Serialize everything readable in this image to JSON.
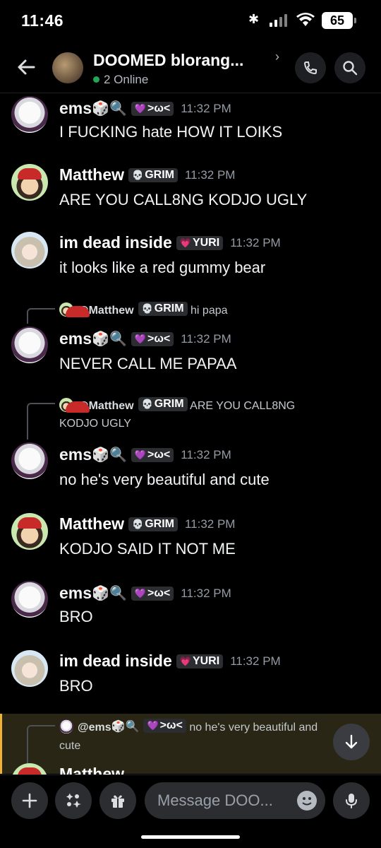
{
  "status": {
    "time": "11:46",
    "battery": "65"
  },
  "header": {
    "title": "DOOMED blorang...",
    "online": "2 Online"
  },
  "messages": [
    {
      "author": "ems",
      "tag": ">ω<",
      "time": "11:32 PM",
      "text": "I FUCKING hate HOW IT LOIKS"
    },
    {
      "author": "Matthew",
      "tag": "GRIM",
      "time": "11:32 PM",
      "text": "ARE YOU CALL8NG KODJO UGLY"
    },
    {
      "author": "im dead inside",
      "tag": "YURI",
      "time": "11:32 PM",
      "text": "it looks like a red gummy bear"
    },
    {
      "author": "ems",
      "tag": ">ω<",
      "time": "11:32 PM",
      "text": "NEVER CALL ME PAPAA",
      "reply": {
        "author": "@Matthew",
        "tag": "GRIM",
        "text": "hi papa"
      }
    },
    {
      "author": "ems",
      "tag": ">ω<",
      "time": "11:32 PM",
      "text": "no he's very beautiful and cute",
      "reply": {
        "author": "@Matthew",
        "tag": "GRIM",
        "text": "ARE YOU CALL8NG",
        "text2": "KODJO UGLY"
      }
    },
    {
      "author": "Matthew",
      "tag": "GRIM",
      "time": "11:32 PM",
      "text": "KODJO SAID IT NOT ME"
    },
    {
      "author": "ems",
      "tag": ">ω<",
      "time": "11:32 PM",
      "text": "BRO"
    },
    {
      "author": "im dead inside",
      "tag": "YURI",
      "time": "11:32 PM",
      "text": "BRO"
    },
    {
      "author": "Matthew",
      "tag": "",
      "reply": {
        "author": "@ems",
        "tag": ">ω<",
        "text": "no he's very beautiful and",
        "text2": "cute"
      }
    }
  ],
  "composer": {
    "placeholder": "Message DOO..."
  },
  "colors": {
    "accent": "#5865f2",
    "online": "#23a55a",
    "highlight_bar": "#f0b232"
  }
}
